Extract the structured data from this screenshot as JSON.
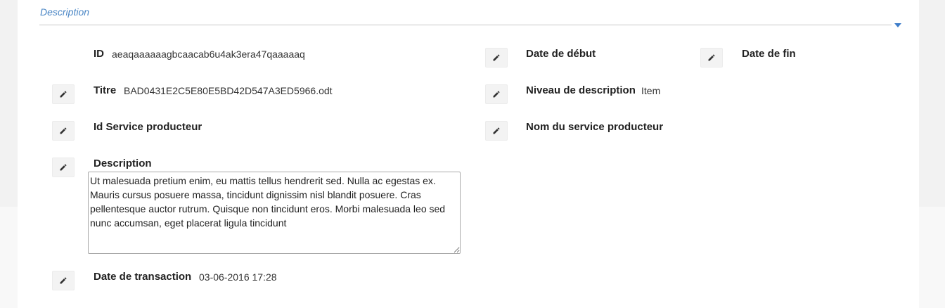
{
  "section": {
    "title": "Description"
  },
  "fields": {
    "id": {
      "label": "ID",
      "value": "aeaqaaaaaagbcaacab6u4ak3era47qaaaaaq"
    },
    "date_debut": {
      "label": "Date de début",
      "value": ""
    },
    "date_fin": {
      "label": "Date de fin",
      "value": ""
    },
    "titre": {
      "label": "Titre",
      "value": "BAD0431E2C5E80E5BD42D547A3ED5966.odt"
    },
    "niveau": {
      "label": "Niveau de description",
      "value": "Item"
    },
    "id_service": {
      "label": "Id Service producteur",
      "value": ""
    },
    "nom_service": {
      "label": "Nom du service producteur",
      "value": ""
    },
    "description": {
      "label": "Description",
      "value": "Ut malesuada pretium enim, eu mattis tellus hendrerit sed. Nulla ac egestas ex. Mauris cursus posuere massa, tincidunt dignissim nisl blandit posuere. Cras pellentesque auctor rutrum. Quisque non tincidunt eros. Morbi malesuada leo sed nunc accumsan, eget placerat ligula tincidunt"
    },
    "date_transaction": {
      "label": "Date de transaction",
      "value": "03-06-2016 17:28"
    }
  },
  "icons": {
    "edit": "pencil-icon",
    "collapse": "caret-down-icon"
  },
  "colors": {
    "accent": "#4a86c5",
    "panel": "#ffffff",
    "background": "#f2f2f2"
  }
}
